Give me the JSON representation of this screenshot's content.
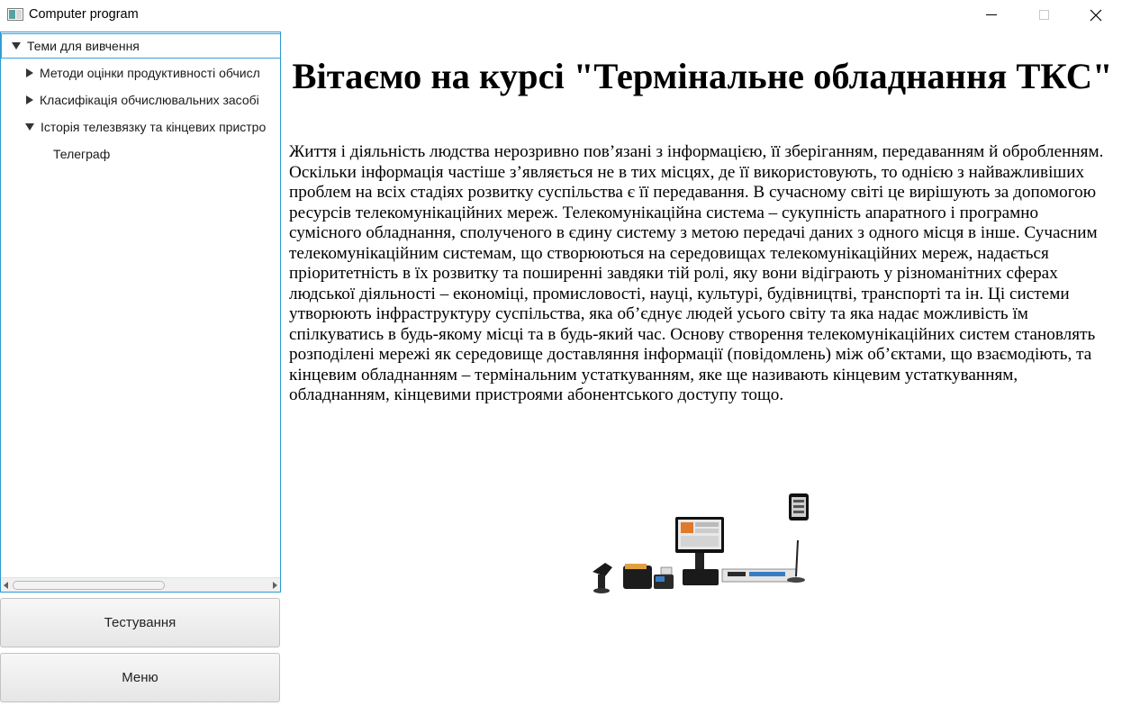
{
  "window": {
    "title": "Computer program",
    "controls": [
      "minimize-icon",
      "maximize-icon",
      "close-icon"
    ]
  },
  "tree": {
    "items": [
      {
        "label": "Теми для вивчення",
        "level": 0,
        "expanded": true,
        "selected": true
      },
      {
        "label": "Методи оцінки продуктивності обчисл",
        "level": 1,
        "expanded": false
      },
      {
        "label": "Класифікація обчислювальних засобі",
        "level": 1,
        "expanded": false
      },
      {
        "label": "Історія телезвязку та кінцевих пристро",
        "level": 1,
        "expanded": true
      },
      {
        "label": "Телеграф",
        "level": 2
      }
    ]
  },
  "buttons": {
    "test_label": "Тестування",
    "menu_label": "Меню"
  },
  "content": {
    "heading": "Вітаємо на курсі \"Термінальне обладнання ТКС\"",
    "paragraph": "Життя і діяльність людства нерозривно пов’язані з інформацією, її зберіганням, передаванням й обробленням. Оскільки інформація частіше з’являється не в тих місцях, де її використовують, то однією з найважливіших проблем на всіх стадіях розвитку суспільства є її передавання. В сучасному світі це вирішують за допомогою ресурсів телекомунікаційних мереж. Телекомунікаційна система – сукупність апаратного і програмно сумісного обладнання, сполученого в єдину систему з метою передачі даних з одного місця в інше. Сучасним телекомунікаційним системам, що створюються на середовищах телекомунікаційних мереж, надається пріоритетність в їх розвитку та поширенні завдяки тій ролі, яку вони відіграють у різноманітних сферах людської діяльності – економіці, промисловості, науці, культурі, будівництві, транспорті та ін. Ці системи утворюють інфраструктуру суспільства, яка об’єднує людей усього світу та яка надає можливість їм спілкуватись в будь-якому місці та в будь-який час. Основу створення телекомунікаційних систем становлять розподілені мережі як середовище доставляння інформації (повідомлень) між об’єктами, що взаємодіють, та кінцевим обладнанням – термінальним устаткуванням, яке ще називають кінцевим устаткуванням, обладнанням, кінцевими пристроями абонентського доступу тощо."
  },
  "colors": {
    "focus_border": "#2b9bd1",
    "text": "#000000"
  }
}
